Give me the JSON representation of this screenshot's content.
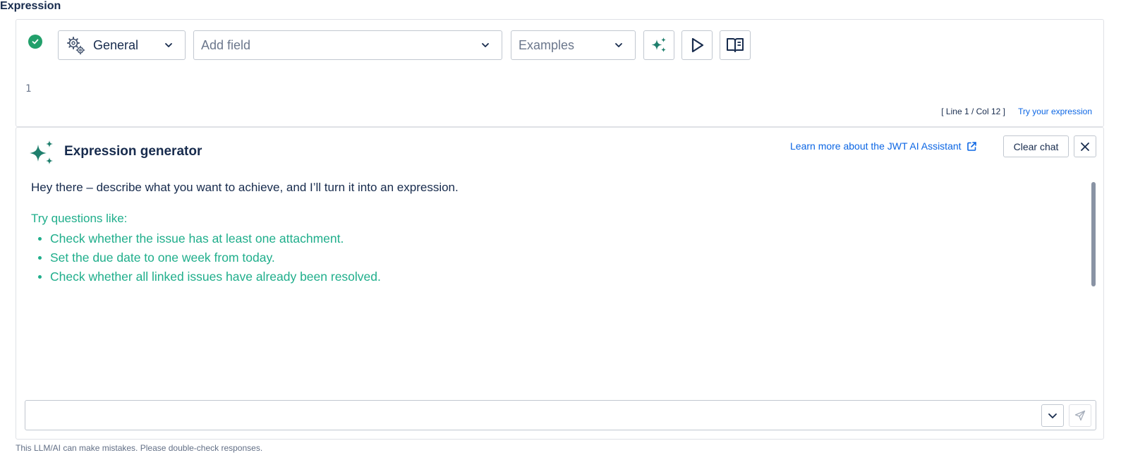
{
  "field_label": "Expression",
  "toolbar": {
    "status_icon": "check-circle-icon",
    "context_select": {
      "value": "General",
      "icon": "gears-icon"
    },
    "field_select": {
      "placeholder": "Add field"
    },
    "examples_select": {
      "placeholder": "Examples"
    },
    "buttons": [
      {
        "name": "ai-assistant-button",
        "icon": "sparkles-icon"
      },
      {
        "name": "run-button",
        "icon": "play-icon"
      },
      {
        "name": "documentation-button",
        "icon": "book-icon"
      }
    ]
  },
  "editor": {
    "line_numbers": [
      "1"
    ],
    "cursor_position": "[ Line 1 / Col 12 ]",
    "try_link": "Try your expression"
  },
  "generator": {
    "title": "Expression generator",
    "learn_more": "Learn more about the JWT AI Assistant",
    "clear_chat": "Clear chat",
    "intro": "Hey there – describe what you want to achieve, and I’ll turn it into an expression.",
    "suggestions_heading": "Try questions like:",
    "suggestions": [
      "Check whether the issue has at least one attachment.",
      "Set the due date to one week from today.",
      "Check whether all linked issues have already been resolved."
    ],
    "input": {
      "placeholder": "",
      "value": ""
    }
  },
  "disclaimer": "This LLM/AI can make mistakes. Please double-check responses.",
  "colors": {
    "accent_teal": "#1fae8b",
    "success_green": "#22a06b",
    "link_blue": "#0c66e4",
    "text_dark": "#172b4d",
    "border": "#c1c7d0"
  }
}
